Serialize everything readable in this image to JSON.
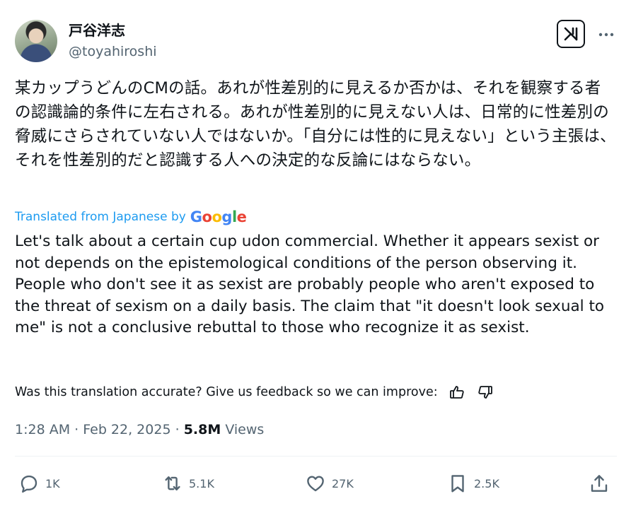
{
  "author": {
    "display_name": "戸谷洋志",
    "handle": "@toyahiroshi"
  },
  "tweet": {
    "text_jp": "某カップうどんのCMの話。あれが性差別的に見えるか否かは、それを観察する者の認識論的条件に左右される。あれが性差別的に見えない人は、日常的に性差別の脅威にさらされていない人ではないか。「自分には性的に見えない」という主張は、それを性差別的だと認識する人への決定的な反論にはならない。",
    "translated_label": "Translated from Japanese by",
    "translator_logo": "Google",
    "text_en": "Let's talk about a certain cup udon commercial. Whether it appears sexist or not depends on the epistemological conditions of the person observing it. People who don't see it as sexist are probably people who aren't exposed to the threat of sexism on a daily basis. The claim that \"it doesn't look sexual to me\" is not a conclusive rebuttal to those who recognize it as sexist.",
    "feedback_prompt": "Was this translation accurate? Give us feedback so we can improve:"
  },
  "meta": {
    "time": "1:28 AM",
    "separator": "·",
    "date": "Feb 22, 2025",
    "views_count": "5.8M",
    "views_label": "Views"
  },
  "actions": {
    "replies": "1K",
    "reposts": "5.1K",
    "likes": "27K",
    "bookmarks": "2.5K"
  },
  "icons": [
    "grok-icon",
    "more-icon",
    "thumbs-up-icon",
    "thumbs-down-icon",
    "reply-icon",
    "repost-icon",
    "like-icon",
    "bookmark-icon",
    "share-icon"
  ],
  "colors": {
    "text": "#0f1419",
    "secondary": "#536471",
    "link": "#1d9bf0"
  }
}
